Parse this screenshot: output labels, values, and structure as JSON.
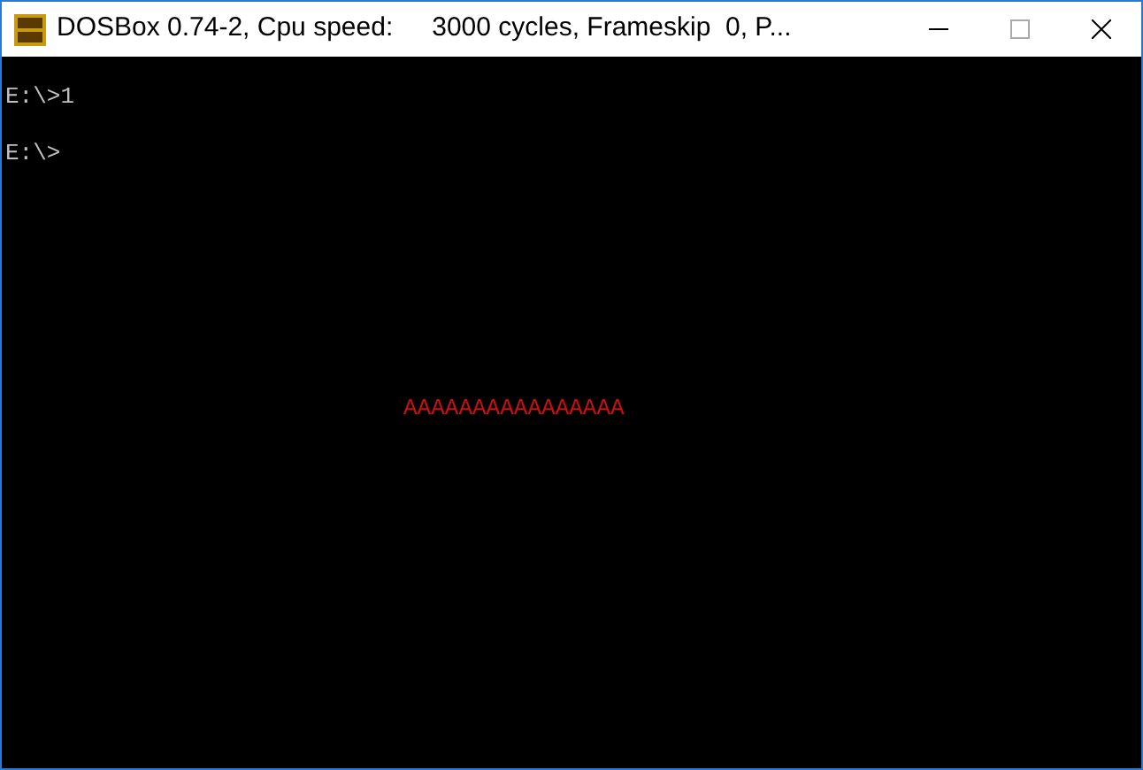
{
  "window": {
    "title": "DOSBox 0.74-2, Cpu speed:",
    "status": "3000 cycles, Frameskip  0, P..."
  },
  "console": {
    "lines": [
      "E:\\>1",
      "E:\\>"
    ],
    "output": "AAAAAAAAAAAAAAAA"
  }
}
